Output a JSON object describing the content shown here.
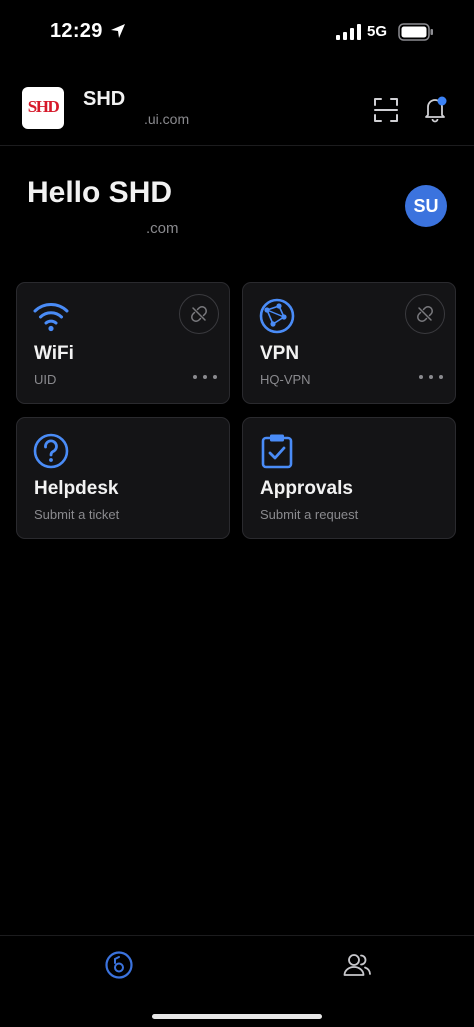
{
  "status_bar": {
    "time": "12:29",
    "network": "5G"
  },
  "header": {
    "logo_text": "SHD",
    "org_name": "SHD",
    "org_domain": ".ui.com"
  },
  "greeting": {
    "title": "Hello SHD",
    "subtitle": ".com",
    "avatar_initials": "SU"
  },
  "cards": [
    {
      "title": "WiFi",
      "subtitle": "UID",
      "icon": "wifi-icon"
    },
    {
      "title": "VPN",
      "subtitle": "HQ-VPN",
      "icon": "vpn-globe-icon"
    },
    {
      "title": "Helpdesk",
      "subtitle": "Submit a ticket",
      "icon": "question-circle-icon"
    },
    {
      "title": "Approvals",
      "subtitle": "Submit a request",
      "icon": "clipboard-check-icon"
    }
  ],
  "tabbar": {
    "items": [
      {
        "icon": "home-key-icon",
        "active": true
      },
      {
        "icon": "users-icon",
        "active": false
      }
    ]
  },
  "colors": {
    "accent": "#4a8cf7",
    "background": "#000000",
    "card": "#141416",
    "avatar": "#3b73de",
    "notification_dot": "#3b82f6"
  }
}
